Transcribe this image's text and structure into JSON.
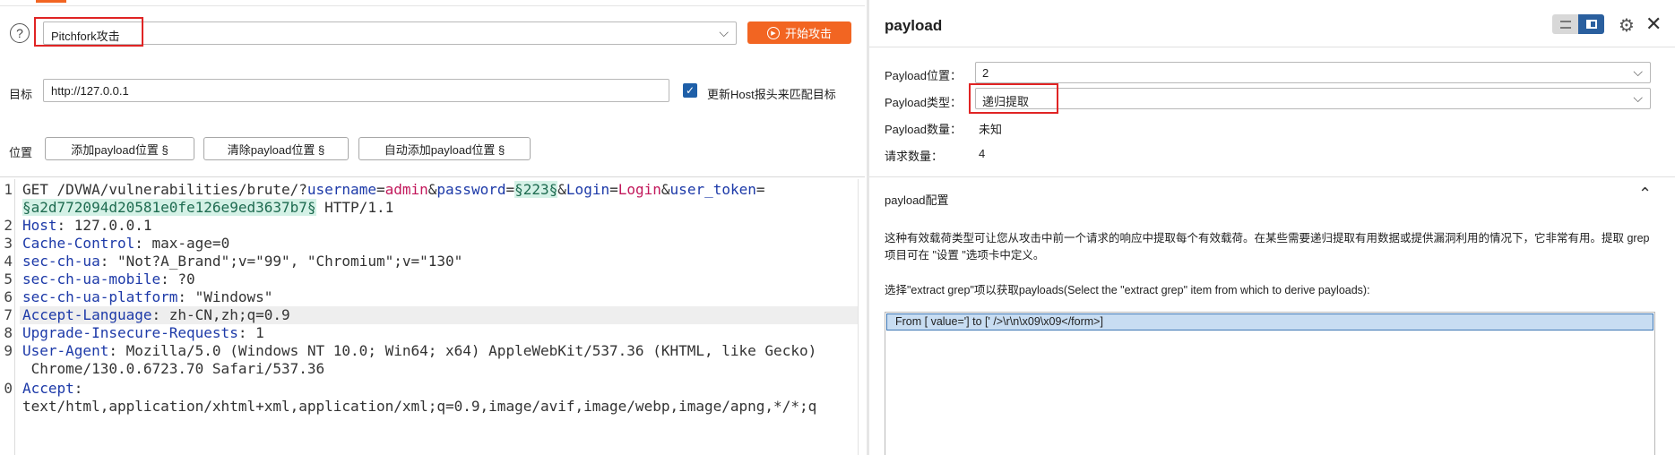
{
  "attack": {
    "type_value": "Pitchfork攻击",
    "start_label": "开始攻击"
  },
  "target": {
    "label": "目标",
    "value": "http://127.0.0.1",
    "update_host_label": "更新Host报头来匹配目标",
    "update_host_checked": true
  },
  "positions": {
    "label": "位置",
    "buttons": [
      "添加payload位置 §",
      "清除payload位置 §",
      "自动添加payload位置 §"
    ]
  },
  "request_lines": [
    {
      "num": "1",
      "method_path": "GET /DVWA/vulnerabilities/brute/?",
      "p1": "username",
      "eq1": "=",
      "v1": "admin",
      "amp1": "&",
      "p2": "password",
      "eq2": "=",
      "pl1": "§223§",
      "amp2": "&",
      "p3": "Login",
      "eq3": "=",
      "v3": "Login",
      "amp3": "&",
      "p4": "user_token",
      "eq4": "="
    },
    {
      "num": "",
      "pl2": "§a2d772094d20581e0fe126e9ed3637b7§",
      "tail": " HTTP/1.1"
    },
    {
      "num": "2",
      "key": "Host",
      "value": ": 127.0.0.1"
    },
    {
      "num": "3",
      "key": "Cache-Control",
      "value": ": max-age=0"
    },
    {
      "num": "4",
      "key": "sec-ch-ua",
      "value": ": \"Not?A_Brand\";v=\"99\", \"Chromium\";v=\"130\""
    },
    {
      "num": "5",
      "key": "sec-ch-ua-mobile",
      "value": ": ?0"
    },
    {
      "num": "6",
      "key": "sec-ch-ua-platform",
      "value": ": \"Windows\""
    },
    {
      "num": "7",
      "key": "Accept-Language",
      "value": ": zh-CN,zh;q=0.9"
    },
    {
      "num": "8",
      "key": "Upgrade-Insecure-Requests",
      "value": ": 1"
    },
    {
      "num": "9",
      "key": "User-Agent",
      "value": ": Mozilla/5.0 (Windows NT 10.0; Win64; x64) AppleWebKit/537.36 (KHTML, like Gecko)"
    },
    {
      "num": "",
      "cont": " Chrome/130.0.6723.70 Safari/537.36"
    },
    {
      "num": "0",
      "key": "Accept",
      "value": ":"
    },
    {
      "num": "",
      "cont": "text/html,application/xhtml+xml,application/xml;q=0.9,image/avif,image/webp,image/apng,*/*;q"
    }
  ],
  "payload_panel": {
    "title": "payload",
    "position_label": "Payload位置：",
    "position_value": "2",
    "type_label": "Payload类型：",
    "type_value": "递归提取",
    "count_label": "Payload数量：",
    "count_value": "未知",
    "requests_label": "请求数量：",
    "requests_value": "4",
    "config_title": "payload配置",
    "description": "这种有效载荷类型可让您从攻击中前一个请求的响应中提取每个有效载荷。在某些需要递归提取有用数据或提供漏洞利用的情况下，它非常有用。提取 grep 项目可在 \"设置 \"选项卡中定义。",
    "choose_label": "选择\"extract grep\"项以获取payloads(Select the \"extract grep\" item from which to derive payloads):",
    "grep_items": [
      "From [ value='] to [' />\\r\\n\\x09\\x09</form>]"
    ]
  },
  "colors": {
    "accent": "#f26522",
    "highlight_border": "#e02424",
    "payload_bg": "#d4f1e6",
    "key_blue": "#1c39a8",
    "value_red": "#c2185b",
    "toggle_active": "#2a5f9e"
  },
  "icons": [
    "help-icon",
    "play-icon",
    "chevron-down-icon",
    "checkbox-checked-icon",
    "layout-horizontal-icon",
    "layout-vertical-icon",
    "gear-icon",
    "close-icon",
    "chevron-up-icon"
  ]
}
